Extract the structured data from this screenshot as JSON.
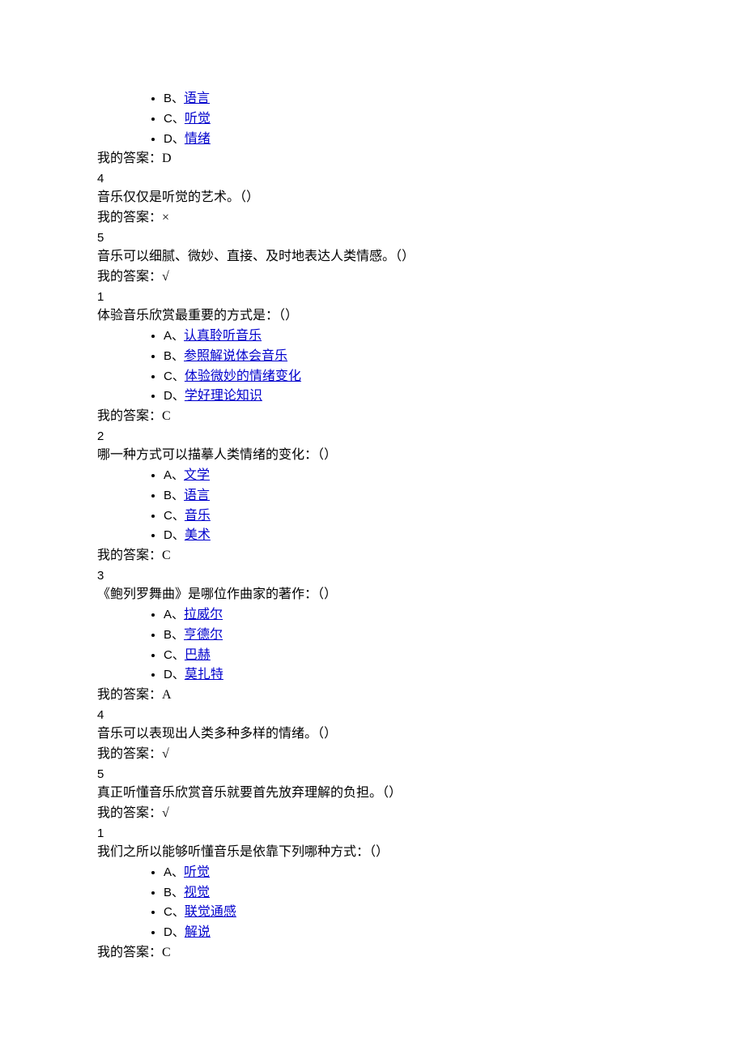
{
  "block1": {
    "opts": [
      {
        "label": "B、",
        "text": "语言"
      },
      {
        "label": "C、",
        "text": "听觉"
      },
      {
        "label": "D、",
        "text": "情绪"
      }
    ],
    "answer": "我的答案：D"
  },
  "block2": {
    "num": "4",
    "q": "音乐仅仅是听觉的艺术。（）",
    "answer": "我的答案：×"
  },
  "block3": {
    "num": "5",
    "q": "音乐可以细腻、微妙、直接、及时地表达人类情感。（）",
    "answer": "我的答案：√"
  },
  "block4": {
    "num": "1",
    "q": "体验音乐欣赏最重要的方式是：（）",
    "opts": [
      {
        "label": "A、",
        "text": "认真聆听音乐"
      },
      {
        "label": "B、",
        "text": "参照解说体会音乐"
      },
      {
        "label": "C、",
        "text": "体验微妙的情绪变化"
      },
      {
        "label": "D、",
        "text": "学好理论知识"
      }
    ],
    "answer": "我的答案：C"
  },
  "block5": {
    "num": "2",
    "q": "哪一种方式可以描摹人类情绪的变化：（）",
    "opts": [
      {
        "label": "A、",
        "text": "文学"
      },
      {
        "label": "B、",
        "text": "语言"
      },
      {
        "label": "C、",
        "text": "音乐"
      },
      {
        "label": "D、",
        "text": "美术"
      }
    ],
    "answer": "我的答案：C"
  },
  "block6": {
    "num": "3",
    "q": "《鲍列罗舞曲》是哪位作曲家的著作：（）",
    "opts": [
      {
        "label": "A、",
        "text": "拉威尔"
      },
      {
        "label": "B、",
        "text": "亨德尔"
      },
      {
        "label": "C、",
        "text": "巴赫"
      },
      {
        "label": "D、",
        "text": "莫扎特"
      }
    ],
    "answer": "我的答案：A"
  },
  "block7": {
    "num": "4",
    "q": "音乐可以表现出人类多种多样的情绪。（）",
    "answer": "我的答案：√"
  },
  "block8": {
    "num": "5",
    "q": "真正听懂音乐欣赏音乐就要首先放弃理解的负担。（）",
    "answer": "我的答案：√"
  },
  "block9": {
    "num": "1",
    "q": "我们之所以能够听懂音乐是依靠下列哪种方式：（）",
    "opts": [
      {
        "label": "A、",
        "text": "听觉"
      },
      {
        "label": "B、",
        "text": "视觉"
      },
      {
        "label": "C、",
        "text": "联觉通感"
      },
      {
        "label": "D、",
        "text": "解说"
      }
    ],
    "answer": "我的答案：C"
  }
}
